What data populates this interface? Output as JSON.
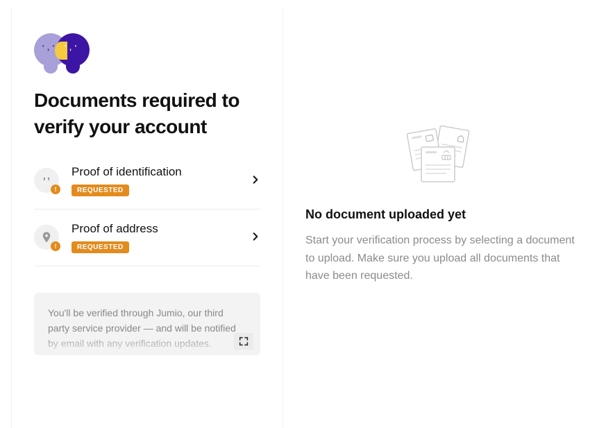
{
  "left": {
    "heading": "Documents required to verify your account",
    "document_items": [
      {
        "title": "Proof of identification",
        "status_label": "REQUESTED",
        "icon": "face-icon"
      },
      {
        "title": "Proof of address",
        "status_label": "REQUESTED",
        "icon": "pin-icon"
      }
    ],
    "info_text": "You'll be verified through Jumio, our third party service provider — and will be notified by email with any verification updates."
  },
  "right": {
    "empty_title": "No document uploaded yet",
    "empty_text": "Start your verification process by selecting a document to upload. Make sure you upload all documents that have been requested."
  },
  "colors": {
    "status_badge": "#e38b1c",
    "avatar_primary": "#3c15a5",
    "avatar_secondary": "#a8a0d8",
    "avatar_accent": "#f5c940"
  }
}
